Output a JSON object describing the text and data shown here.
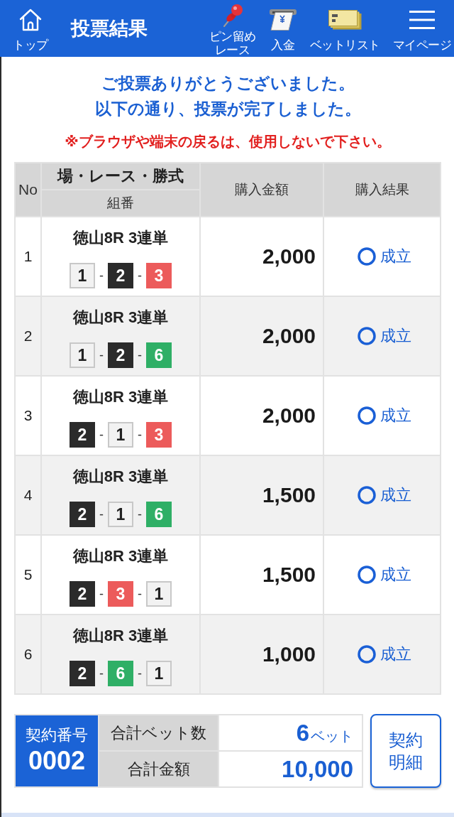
{
  "header": {
    "nav_left": {
      "kind": "home",
      "lines": [
        "トップ"
      ]
    },
    "title": "投票結果",
    "nav": [
      {
        "kind": "pin",
        "lines": [
          "ピン留め",
          "レース"
        ]
      },
      {
        "kind": "deposit",
        "lines": [
          "入金"
        ]
      },
      {
        "kind": "bet_list",
        "lines": [
          "ベットリスト"
        ]
      },
      {
        "kind": "menu",
        "lines": [
          "マイページ"
        ]
      }
    ]
  },
  "messages": {
    "thanks": [
      "ご投票ありがとうございました。",
      "以下の通り、投票が完了しました。"
    ],
    "warning": "※ブラウザや端末の戻るは、使用しないで下さい。"
  },
  "table": {
    "columns": {
      "no": "No",
      "race": "場・レース・勝式",
      "combination": "組番",
      "amount": "購入金額",
      "result": "購入結果"
    },
    "rows": [
      {
        "no": "1",
        "race": "徳山8R 3連単",
        "combination": [
          {
            "kind": "number",
            "text": "1",
            "color": "#f2f2f2"
          },
          {
            "kind": "separator",
            "text": "-"
          },
          {
            "kind": "number",
            "text": "2",
            "color": "#2b2b2b"
          },
          {
            "kind": "separator",
            "text": "-"
          },
          {
            "kind": "number",
            "text": "3",
            "color": "#ec5b5b"
          }
        ],
        "amount": "2,000",
        "result": "成立"
      },
      {
        "no": "2",
        "race": "徳山8R 3連単",
        "combination": [
          {
            "kind": "number",
            "text": "1",
            "color": "#f2f2f2"
          },
          {
            "kind": "separator",
            "text": "-"
          },
          {
            "kind": "number",
            "text": "2",
            "color": "#2b2b2b"
          },
          {
            "kind": "separator",
            "text": "-"
          },
          {
            "kind": "number",
            "text": "6",
            "color": "#2faf66"
          }
        ],
        "amount": "2,000",
        "result": "成立"
      },
      {
        "no": "3",
        "race": "徳山8R 3連単",
        "combination": [
          {
            "kind": "number",
            "text": "2",
            "color": "#2b2b2b"
          },
          {
            "kind": "separator",
            "text": "-"
          },
          {
            "kind": "number",
            "text": "1",
            "color": "#f2f2f2"
          },
          {
            "kind": "separator",
            "text": "-"
          },
          {
            "kind": "number",
            "text": "3",
            "color": "#ec5b5b"
          }
        ],
        "amount": "2,000",
        "result": "成立"
      },
      {
        "no": "4",
        "race": "徳山8R 3連単",
        "combination": [
          {
            "kind": "number",
            "text": "2",
            "color": "#2b2b2b"
          },
          {
            "kind": "separator",
            "text": "-"
          },
          {
            "kind": "number",
            "text": "1",
            "color": "#f2f2f2"
          },
          {
            "kind": "separator",
            "text": "-"
          },
          {
            "kind": "number",
            "text": "6",
            "color": "#2faf66"
          }
        ],
        "amount": "1,500",
        "result": "成立"
      },
      {
        "no": "5",
        "race": "徳山8R 3連単",
        "combination": [
          {
            "kind": "number",
            "text": "2",
            "color": "#2b2b2b"
          },
          {
            "kind": "separator",
            "text": "-"
          },
          {
            "kind": "number",
            "text": "3",
            "color": "#ec5b5b"
          },
          {
            "kind": "separator",
            "text": "-"
          },
          {
            "kind": "number",
            "text": "1",
            "color": "#f2f2f2"
          }
        ],
        "amount": "1,500",
        "result": "成立"
      },
      {
        "no": "6",
        "race": "徳山8R 3連単",
        "combination": [
          {
            "kind": "number",
            "text": "2",
            "color": "#2b2b2b"
          },
          {
            "kind": "separator",
            "text": "-"
          },
          {
            "kind": "number",
            "text": "6",
            "color": "#2faf66"
          },
          {
            "kind": "separator",
            "text": "-"
          },
          {
            "kind": "number",
            "text": "1",
            "color": "#f2f2f2"
          }
        ],
        "amount": "1,000",
        "result": "成立"
      }
    ]
  },
  "footer": {
    "contract": {
      "label": "契約番号",
      "number": "0002"
    },
    "totals": [
      {
        "label": "合計ベット数",
        "value": "6",
        "unit": "ベット"
      },
      {
        "label": "合計金額",
        "value": "10,000"
      }
    ],
    "detail_button": {
      "lines": [
        "契約",
        "明細"
      ]
    }
  }
}
